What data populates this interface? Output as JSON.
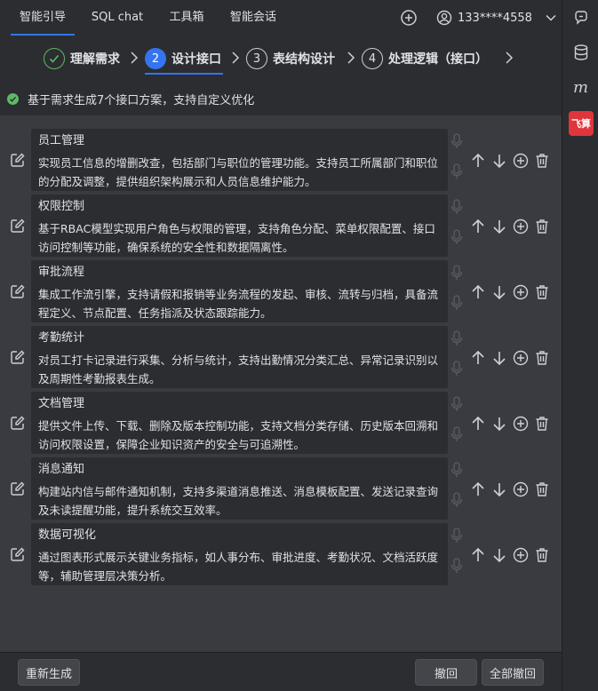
{
  "nav": {
    "tabs": [
      {
        "label": "智能引导",
        "active": true
      },
      {
        "label": "SQL chat",
        "active": false
      },
      {
        "label": "工具箱",
        "active": false
      },
      {
        "label": "智能会话",
        "active": false
      }
    ],
    "user": "133****4558"
  },
  "steps": [
    {
      "num": "✓",
      "label": "理解需求",
      "state": "done"
    },
    {
      "num": "2",
      "label": "设计接口",
      "state": "active"
    },
    {
      "num": "3",
      "label": "表结构设计",
      "state": "todo"
    },
    {
      "num": "4",
      "label": "处理逻辑（接口）",
      "state": "todo"
    }
  ],
  "info": "基于需求生成7个接口方案，支持自定义优化",
  "cards": [
    {
      "title": "员工管理",
      "desc": "实现员工信息的增删改查，包括部门与职位的管理功能。支持员工所属部门和职位的分配及调整，提供组织架构展示和人员信息维护能力。"
    },
    {
      "title": "权限控制",
      "desc": "基于RBAC模型实现用户角色与权限的管理，支持角色分配、菜单权限配置、接口访问控制等功能，确保系统的安全性和数据隔离性。"
    },
    {
      "title": "审批流程",
      "desc": "集成工作流引擎，支持请假和报销等业务流程的发起、审核、流转与归档，具备流程定义、节点配置、任务指派及状态跟踪能力。"
    },
    {
      "title": "考勤统计",
      "desc": "对员工打卡记录进行采集、分析与统计，支持出勤情况分类汇总、异常记录识别以及周期性考勤报表生成。"
    },
    {
      "title": "文档管理",
      "desc": "提供文件上传、下载、删除及版本控制功能，支持文档分类存储、历史版本回溯和访问权限设置，保障企业知识资产的安全与可追溯性。"
    },
    {
      "title": "消息通知",
      "desc": "构建站内信与邮件通知机制，支持多渠道消息推送、消息模板配置、发送记录查询及未读提醒功能，提升系统交互效率。"
    },
    {
      "title": "数据可视化",
      "desc": "通过图表形式展示关键业务指标，如人事分布、审批进度、考勤状况、文档活跃度等，辅助管理层决策分析。"
    }
  ],
  "bottom": {
    "regenerate": "重新生成",
    "undo": "撤回",
    "undo_all": "全部撤回"
  },
  "sidebar": {
    "badge": "飞算"
  },
  "colors": {
    "accent": "#3574f0",
    "success": "#5fb865",
    "badge": "#e0353b"
  }
}
